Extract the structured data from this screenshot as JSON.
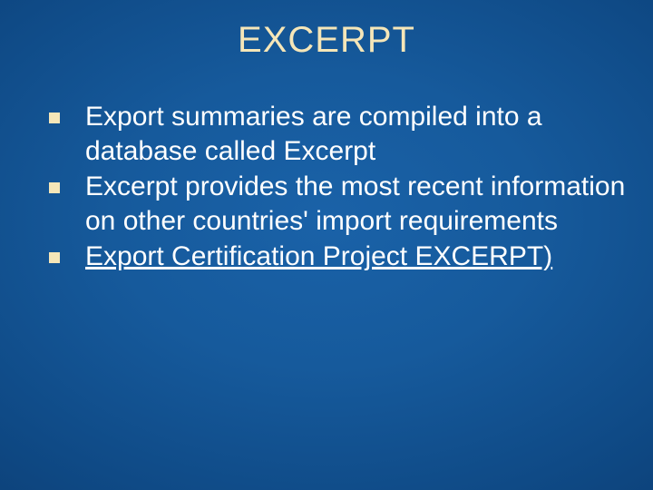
{
  "title": "EXCERPT",
  "bullets": [
    {
      "text": "Export summaries are compiled into a database called Excerpt",
      "link": false
    },
    {
      "text": "Excerpt provides the most recent information on other countries' import requirements",
      "link": false
    },
    {
      "text": "Export Certification Project EXCERPT)",
      "link": true
    }
  ]
}
